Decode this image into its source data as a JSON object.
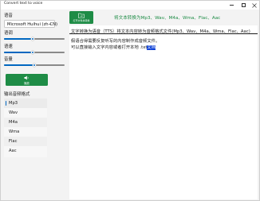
{
  "window": {
    "title": "Convert text to voice"
  },
  "left": {
    "voice_label": "语音",
    "voice_value": "Microsoft Huihui (zh-CN)",
    "pitch_label": "语调",
    "pitch_level": 0.47,
    "rate_label": "语速",
    "rate_level": 0.47,
    "volume_label": "音量",
    "volume_level": 0.5,
    "play_button_label": "播放",
    "formats_label": "输出音频格式",
    "formats": [
      "Mp3",
      "Wav",
      "M4a",
      "Wma",
      "Flac",
      "Aac"
    ],
    "selected_format": "Mp3"
  },
  "right": {
    "convert_button_label": "打开文件并转换",
    "header_text": "将文本转换为Mp3、Wav、M4a、Wma、Flac、Aac",
    "description": "文字转换为语音（TTS）将文本内容转为音频格式文件(Mp3、Wav、M4a、Wma、Flac、Aac)",
    "body_line1": "假语合得需要反复听写的内容制作成音频文件。",
    "body_line2_prefix": "可以直接输入文字内容或者打开本地 .txt",
    "body_line2_highlight": "文档"
  },
  "colors": {
    "green": "#1e8c46",
    "accent": "#0067c0",
    "highlight": "#0c3fd6"
  },
  "icons": {
    "play": "speaker-play-icon",
    "convert": "folder-convert-icon",
    "dropdown": "chevron-down-icon"
  }
}
